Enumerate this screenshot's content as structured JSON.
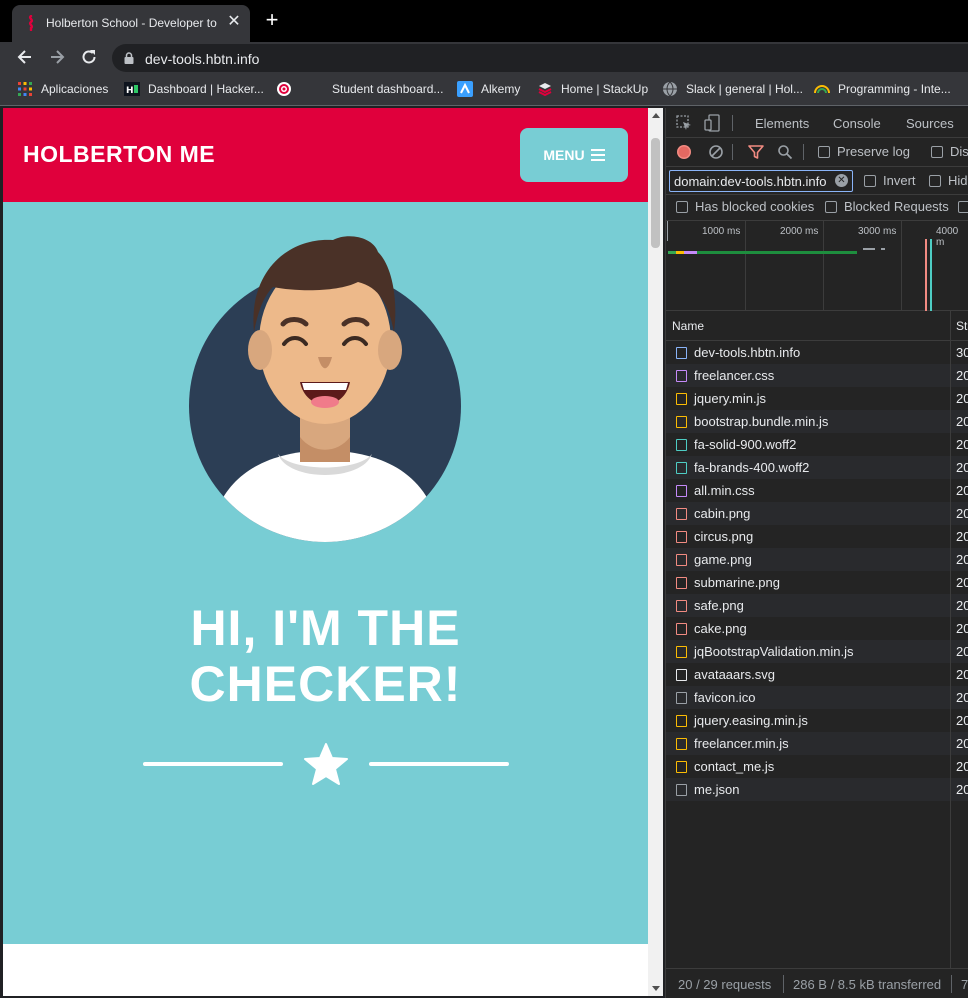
{
  "browser": {
    "tab_title": "Holberton School - Developer to",
    "tab_close": "✕",
    "new_tab": "+",
    "url": "dev-tools.hbtn.info",
    "bookmarks": [
      {
        "label": "Aplicaciones",
        "icon": "apps-grid-icon"
      },
      {
        "label": "Dashboard | Hacker...",
        "icon": "hackerrank-icon"
      },
      {
        "label": "",
        "icon": "target-icon"
      },
      {
        "label": "Student dashboard...",
        "icon": "blank-icon"
      },
      {
        "label": "Alkemy",
        "icon": "alkemy-icon"
      },
      {
        "label": "Home | StackUp",
        "icon": "stackup-icon"
      },
      {
        "label": "Slack | general | Hol...",
        "icon": "globe-icon"
      },
      {
        "label": "Programming - Inte...",
        "icon": "rainbow-icon"
      }
    ]
  },
  "site": {
    "brand": "HOLBERTON ME",
    "menu_label": "MENU",
    "hero_title_line1": "HI, I'M THE",
    "hero_title_line2": "CHECKER!",
    "colors": {
      "nav": "#e0003c",
      "hero": "#78cdd4",
      "accent": "#78cdd4"
    }
  },
  "devtools": {
    "tabs": [
      "Elements",
      "Console",
      "Sources"
    ],
    "preserve_log": "Preserve log",
    "disable_cache": "Dis",
    "filter_value": "domain:dev-tools.hbtn.info",
    "invert": "Invert",
    "hide": "Hid",
    "has_blocked_cookies": "Has blocked cookies",
    "blocked_requests": "Blocked Requests",
    "timeline_ticks": [
      "1000 ms",
      "2000 ms",
      "3000 ms",
      "4000 m"
    ],
    "col_name": "Name",
    "col_status": "Sta",
    "requests": [
      {
        "name": "dev-tools.hbtn.info",
        "status": "30",
        "type": "document"
      },
      {
        "name": "freelancer.css",
        "status": "20",
        "type": "css"
      },
      {
        "name": "jquery.min.js",
        "status": "20",
        "type": "js"
      },
      {
        "name": "bootstrap.bundle.min.js",
        "status": "20",
        "type": "js"
      },
      {
        "name": "fa-solid-900.woff2",
        "status": "20",
        "type": "font"
      },
      {
        "name": "fa-brands-400.woff2",
        "status": "20",
        "type": "font"
      },
      {
        "name": "all.min.css",
        "status": "20",
        "type": "css"
      },
      {
        "name": "cabin.png",
        "status": "20",
        "type": "img"
      },
      {
        "name": "circus.png",
        "status": "20",
        "type": "img"
      },
      {
        "name": "game.png",
        "status": "20",
        "type": "img"
      },
      {
        "name": "submarine.png",
        "status": "20",
        "type": "img"
      },
      {
        "name": "safe.png",
        "status": "20",
        "type": "img"
      },
      {
        "name": "cake.png",
        "status": "20",
        "type": "img"
      },
      {
        "name": "jqBootstrapValidation.min.js",
        "status": "20",
        "type": "js"
      },
      {
        "name": "avataaars.svg",
        "status": "20",
        "type": "svg"
      },
      {
        "name": "favicon.ico",
        "status": "20",
        "type": "other"
      },
      {
        "name": "jquery.easing.min.js",
        "status": "20",
        "type": "js"
      },
      {
        "name": "freelancer.min.js",
        "status": "20",
        "type": "js"
      },
      {
        "name": "contact_me.js",
        "status": "20",
        "type": "js"
      },
      {
        "name": "me.json",
        "status": "20",
        "type": "other"
      }
    ],
    "status_requests": "20 / 29 requests",
    "status_transferred": "286 B / 8.5 kB transferred",
    "status_more": "7"
  }
}
